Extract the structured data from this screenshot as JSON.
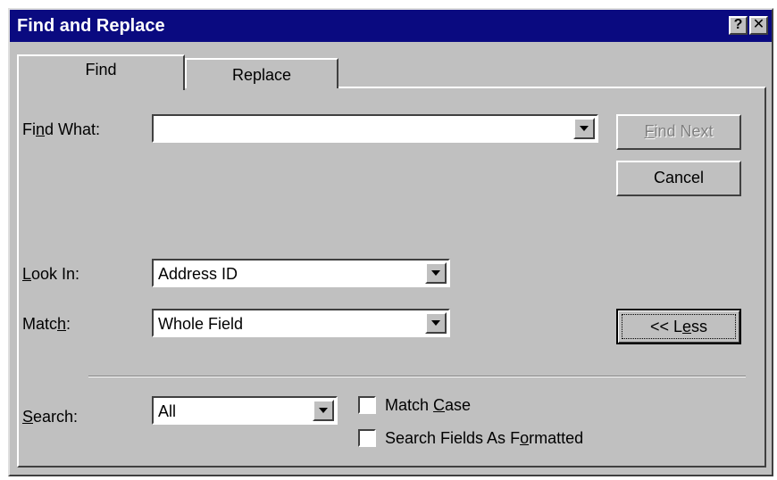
{
  "window": {
    "title": "Find and Replace",
    "help_glyph": "?",
    "close_glyph": "✕",
    "titlebar_color": "#0a0a80",
    "face_color": "#c0c0c0"
  },
  "tabs": [
    {
      "label": "Find",
      "active": true
    },
    {
      "label": "Replace",
      "active": false
    }
  ],
  "find_what": {
    "label_pre": "Fi",
    "label_key": "n",
    "label_post": "d What:",
    "value": ""
  },
  "look_in": {
    "label_pre": "",
    "label_key": "L",
    "label_post": "ook In:",
    "value": "Address ID"
  },
  "match": {
    "label_pre": "Matc",
    "label_key": "h",
    "label_post": ":",
    "value": "Whole Field"
  },
  "search": {
    "label_pre": "",
    "label_key": "S",
    "label_post": "earch:",
    "value": "All"
  },
  "buttons": {
    "find_next": {
      "pre": "",
      "key": "F",
      "post": "ind Next",
      "enabled": false
    },
    "cancel": {
      "label": "Cancel"
    },
    "less": {
      "pre": "<< L",
      "key": "e",
      "post": "ss"
    }
  },
  "checkboxes": {
    "match_case": {
      "pre": "Match ",
      "key": "C",
      "post": "ase",
      "checked": false
    },
    "search_formatted": {
      "pre": "Search Fields As F",
      "key": "o",
      "post": "rmatted",
      "checked": false
    }
  }
}
